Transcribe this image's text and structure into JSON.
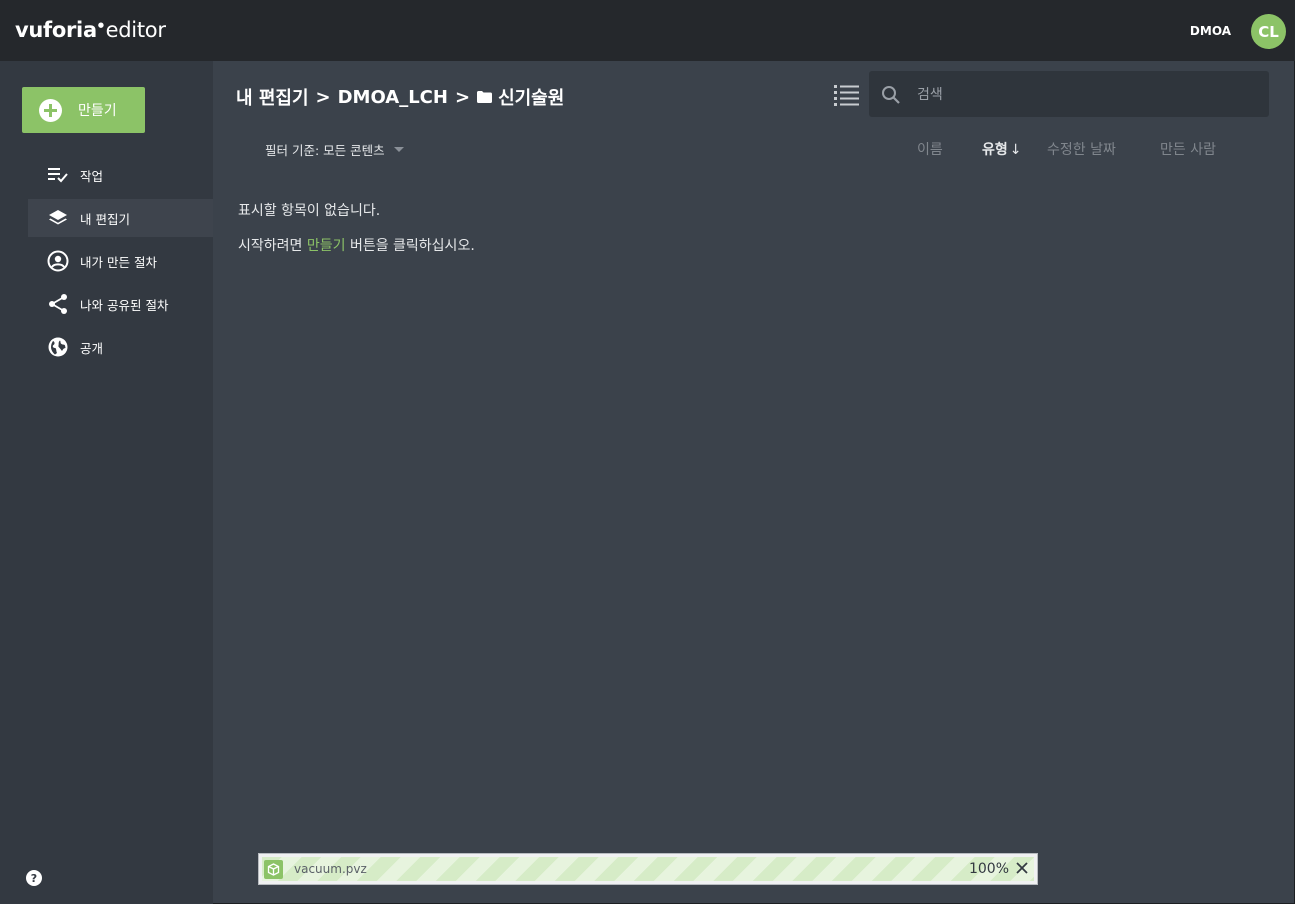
{
  "header": {
    "logo_brand": "vuforia",
    "logo_product": "editor",
    "org_name": "DMOA",
    "avatar_initials": "CL"
  },
  "sidebar": {
    "create_label": "만들기",
    "items": [
      {
        "label": "작업",
        "icon": "tasks-icon"
      },
      {
        "label": "내 편집기",
        "icon": "layers-icon",
        "active": true
      },
      {
        "label": "내가 만든 절차",
        "icon": "user-circle-icon"
      },
      {
        "label": "나와 공유된 절차",
        "icon": "share-icon"
      },
      {
        "label": "공개",
        "icon": "globe-icon"
      }
    ],
    "help_label": "?"
  },
  "breadcrumb": {
    "root": "내 편집기",
    "sep1": ">",
    "middle": "DMOA_LCH",
    "sep2": ">",
    "current": "신기술원"
  },
  "search": {
    "placeholder": "검색"
  },
  "filter": {
    "label": "필터 기준: 모든 콘텐츠"
  },
  "columns": {
    "name": "이름",
    "type": "유형",
    "type_sort_arrow": "↓",
    "modified": "수정한 날짜",
    "creator": "만든 사람"
  },
  "empty_state": {
    "line1": "표시할 항목이 없습니다.",
    "line2_before": "시작하려면 ",
    "line2_link": "만들기",
    "line2_after": " 버튼을 클릭하십시오."
  },
  "upload": {
    "filename": "vacuum.pvz",
    "progress_text": "100%",
    "progress": 1.0
  },
  "colors": {
    "accent": "#8cc367",
    "topbar": "#25282c",
    "sidebar": "#333941",
    "main": "#3b424b"
  }
}
